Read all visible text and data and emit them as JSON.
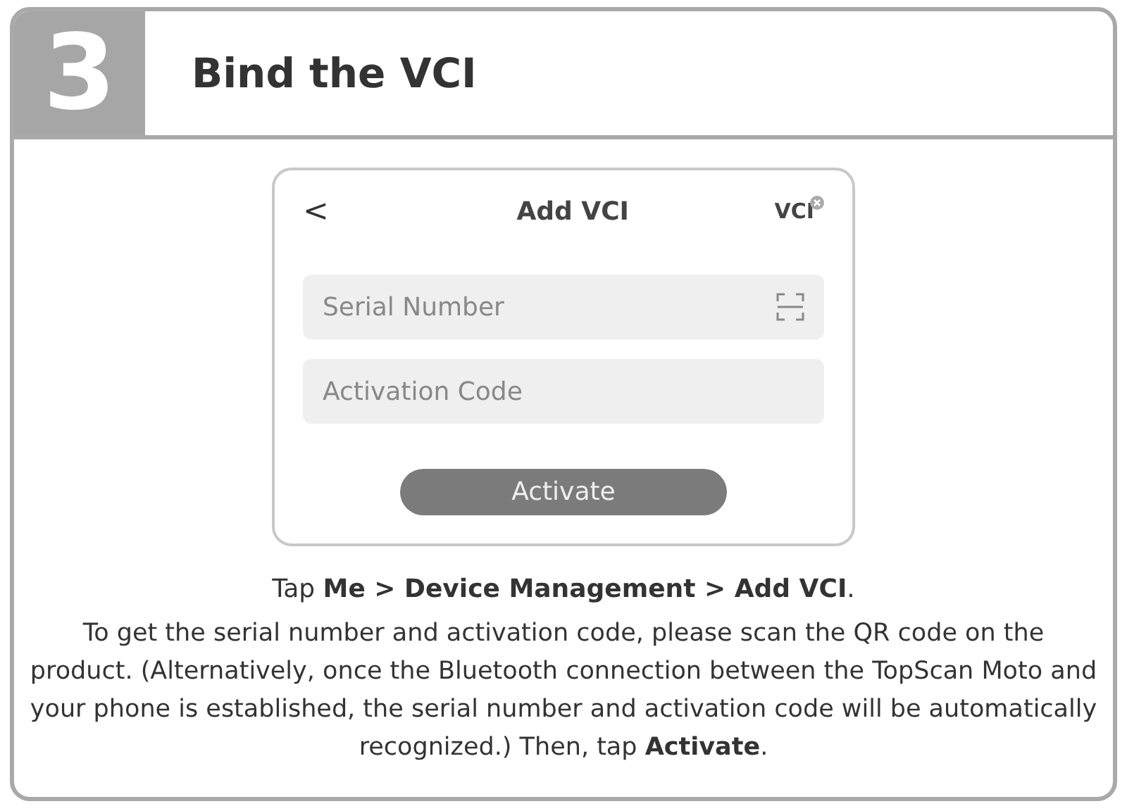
{
  "step": {
    "number": "3",
    "title": "Bind the VCI"
  },
  "phone": {
    "back": "<",
    "title": "Add VCI",
    "vci_badge": "VCI",
    "fields": [
      {
        "placeholder": "Serial Number",
        "scan": true
      },
      {
        "placeholder": "Activation Code",
        "scan": false
      }
    ],
    "button": "Activate"
  },
  "instruction": "Tap **Me > Device Management > Add VCI**.",
  "description": "To get the serial number and activation code, please scan the QR code on the product. (Alternatively, once the Bluetooth connection between the TopScan Moto and your phone is established, the serial number and activation code will be automatically recognized.) Then, tap **Activate**."
}
